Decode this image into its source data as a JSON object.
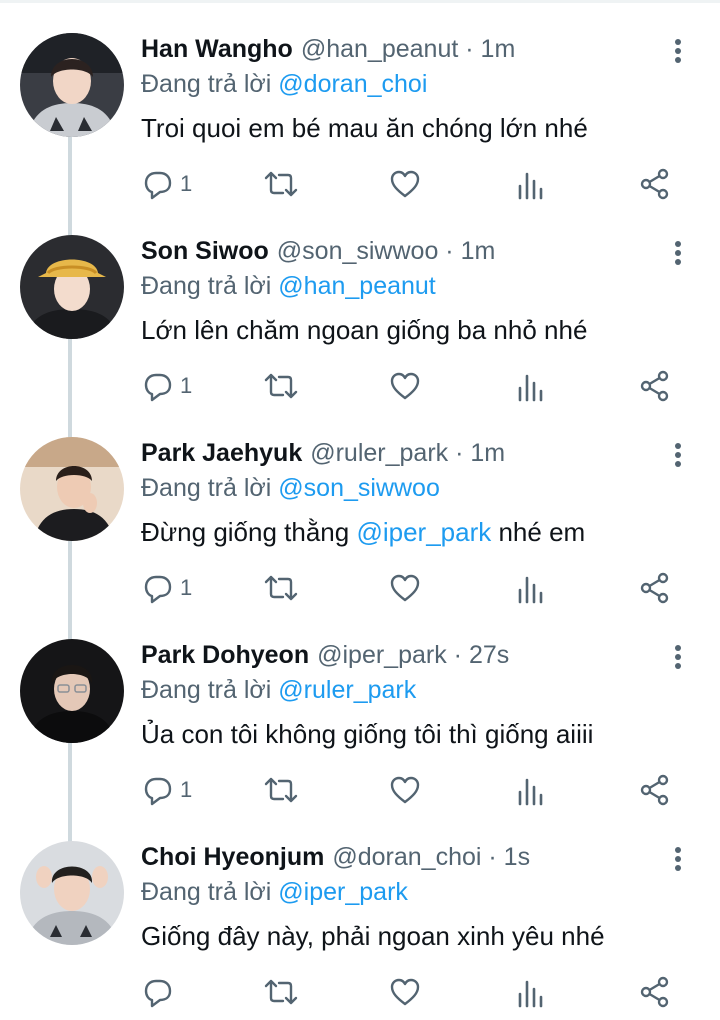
{
  "reply_prefix": "Đang trả lời",
  "colors": {
    "accent": "#1d9bf0",
    "secondary_text": "#536471",
    "thread_line": "#cfd9de"
  },
  "icons": [
    "reply-icon",
    "retweet-icon",
    "like-icon",
    "views-icon",
    "share-icon",
    "more-icon"
  ],
  "tweets": [
    {
      "name": "Han Wangho",
      "handle": "@han_peanut",
      "time": "· 1m",
      "reply_to": "@doran_choi",
      "text_parts": [
        "Troi quoi em bé mau ăn chóng lớn nhé"
      ],
      "reply_count": "1"
    },
    {
      "name": "Son Siwoo",
      "handle": "@son_siwwoo",
      "time": "· 1m",
      "reply_to": "@han_peanut",
      "text_parts": [
        "Lớn lên chăm ngoan giống ba nhỏ nhé"
      ],
      "reply_count": "1"
    },
    {
      "name": "Park Jaehyuk",
      "handle": "@ruler_park",
      "time": "· 1m",
      "reply_to": "@son_siwwoo",
      "text_parts": [
        "Đừng giống thằng ",
        "@iper_park",
        " nhé em"
      ],
      "reply_count": "1"
    },
    {
      "name": "Park Dohyeon",
      "handle": "@iper_park",
      "time": "· 27s",
      "reply_to": "@ruler_park",
      "text_parts": [
        "Ủa con tôi không giống tôi thì giống aiiii"
      ],
      "reply_count": "1"
    },
    {
      "name": "Choi Hyeonjum",
      "handle": "@doran_choi",
      "time": "· 1s",
      "reply_to": "@iper_park",
      "text_parts": [
        "Giống đây này, phải ngoan xinh yêu nhé"
      ],
      "reply_count": ""
    }
  ]
}
